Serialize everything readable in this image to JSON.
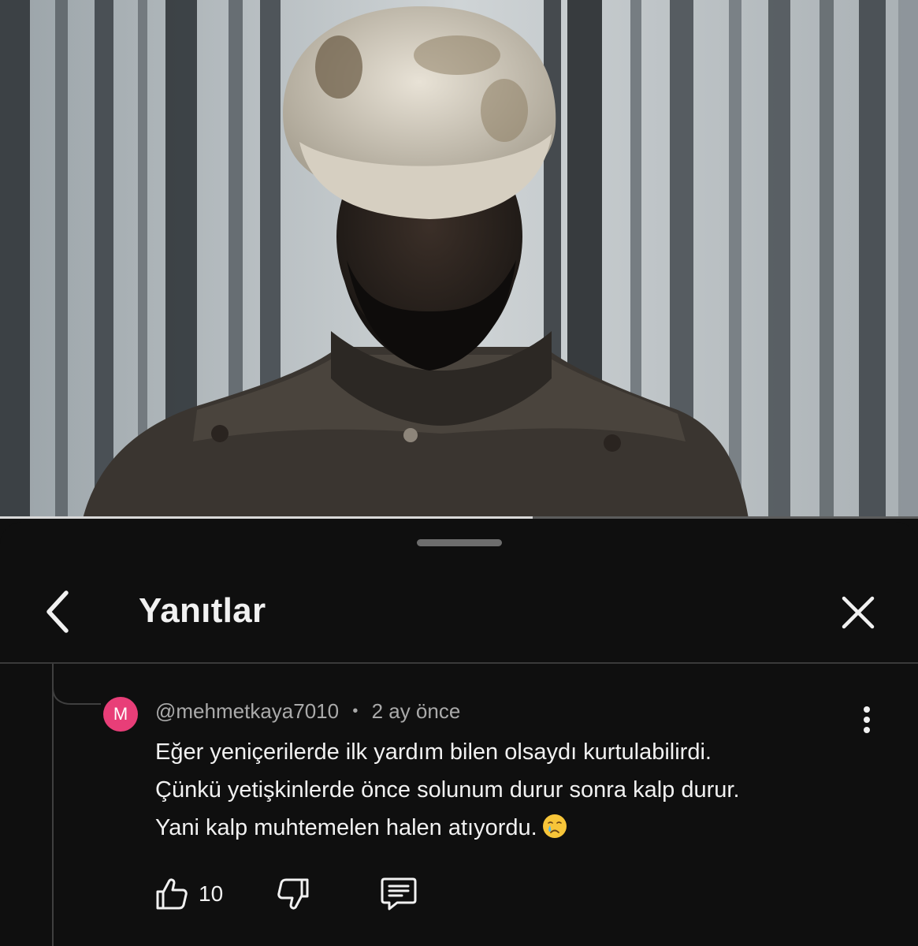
{
  "video": {
    "progress": 0.58
  },
  "sheet": {
    "title": "Yanıtlar"
  },
  "comment": {
    "avatar_letter": "M",
    "avatar_color": "#e83e78",
    "author": "@mehmetkaya7010",
    "separator": "•",
    "time": "2 ay önce",
    "lines": [
      "Eğer yeniçerilerde ilk yardım bilen olsaydı kurtulabilirdi.",
      "Çünkü yetişkinlerde önce solunum durur sonra kalp durur.",
      "Yani kalp muhtemelen halen atıyordu."
    ],
    "emoji": "crying-face-icon",
    "like_count": "10"
  },
  "icons": {
    "back": "chevron-left-icon",
    "close": "close-icon",
    "more": "more-vertical-icon",
    "like": "thumbs-up-icon",
    "dislike": "thumbs-down-icon",
    "reply": "comment-icon"
  }
}
